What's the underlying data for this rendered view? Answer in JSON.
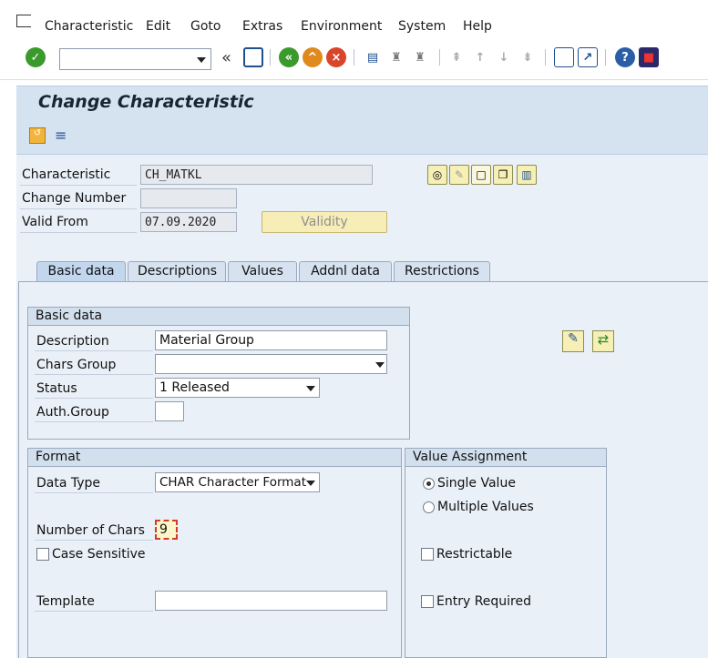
{
  "menu": {
    "items": [
      "Characteristic",
      "Edit",
      "Goto",
      "Extras",
      "Environment",
      "System",
      "Help"
    ]
  },
  "toolbar": {
    "command_field": "",
    "back_glyph": "«"
  },
  "page": {
    "title": "Change Characteristic"
  },
  "header": {
    "characteristic_label": "Characteristic",
    "characteristic_value": "CH_MATKL",
    "change_number_label": "Change Number",
    "change_number_value": "",
    "valid_from_label": "Valid From",
    "valid_from_value": "07.09.2020",
    "validity_button": "Validity"
  },
  "tabs": [
    {
      "label": "Basic data",
      "active": true
    },
    {
      "label": "Descriptions",
      "active": false
    },
    {
      "label": "Values",
      "active": false
    },
    {
      "label": "Addnl data",
      "active": false
    },
    {
      "label": "Restrictions",
      "active": false
    }
  ],
  "basic_data": {
    "title": "Basic data",
    "description_label": "Description",
    "description_value": "Material Group",
    "chars_group_label": "Chars Group",
    "chars_group_value": "",
    "status_label": "Status",
    "status_value": "1 Released",
    "auth_group_label": "Auth.Group",
    "auth_group_value": ""
  },
  "format": {
    "title": "Format",
    "data_type_label": "Data Type",
    "data_type_value": "CHAR Character Format",
    "number_of_chars_label": "Number of Chars",
    "number_of_chars_value": "9",
    "case_sensitive_label": "Case Sensitive",
    "case_sensitive_checked": false,
    "template_label": "Template",
    "template_value": ""
  },
  "value_assignment": {
    "title": "Value Assignment",
    "single_value_label": "Single Value",
    "multiple_values_label": "Multiple Values",
    "selected": "single",
    "restrictable_label": "Restrictable",
    "entry_required_label": "Entry Required"
  },
  "colors": {
    "accent_green": "#3a9a2c",
    "title_bg": "#d5e3f1",
    "content_bg": "#e9f0f8",
    "button_yellow": "#f6f0b6"
  }
}
